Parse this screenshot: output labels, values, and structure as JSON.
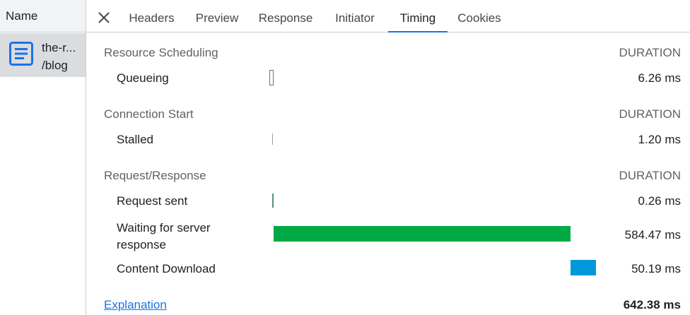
{
  "left": {
    "header": "Name",
    "request": {
      "line1": "the-r...",
      "line2": "/blog",
      "icon": "document-icon"
    }
  },
  "tabs": [
    {
      "label": "Headers",
      "active": false
    },
    {
      "label": "Preview",
      "active": false
    },
    {
      "label": "Response",
      "active": false
    },
    {
      "label": "Initiator",
      "active": false
    },
    {
      "label": "Timing",
      "active": true
    },
    {
      "label": "Cookies",
      "active": false
    }
  ],
  "timing": {
    "duration_header": "DURATION",
    "sections": [
      {
        "title": "Resource Scheduling",
        "rows": [
          {
            "label": "Queueing",
            "duration": "6.26 ms"
          }
        ]
      },
      {
        "title": "Connection Start",
        "rows": [
          {
            "label": "Stalled",
            "duration": "1.20 ms"
          }
        ]
      },
      {
        "title": "Request/Response",
        "rows": [
          {
            "label": "Request sent",
            "duration": "0.26 ms"
          },
          {
            "label_line1": "Waiting for server",
            "label_line2": "response",
            "duration": "584.47 ms"
          },
          {
            "label": "Content Download",
            "duration": "50.19 ms"
          }
        ]
      }
    ],
    "explanation_link": "Explanation",
    "total": "642.38 ms"
  },
  "colors": {
    "accent": "#1a73e8",
    "waiting_bar": "#00a944",
    "download_bar": "#0098db"
  }
}
